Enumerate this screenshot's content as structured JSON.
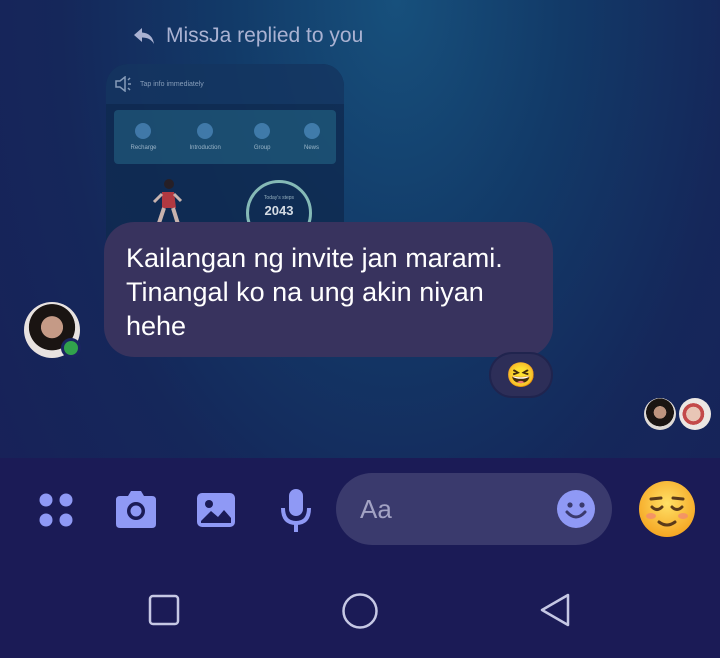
{
  "reply": {
    "header": "MissJa replied to you"
  },
  "quoted_preview": {
    "top_text": "Tap info immediately",
    "menu": [
      "Recharge",
      "Introduction",
      "Group",
      "News"
    ],
    "ring_label": "Today's steps",
    "ring_value": "2043"
  },
  "message": {
    "text": "Kailangan ng invite jan marami. Tinangal ko na ung akin niyan hehe",
    "reaction": "😆"
  },
  "composer": {
    "placeholder": "Aa",
    "quick_emoji": "😌"
  },
  "colors": {
    "accent": "#8f99f5",
    "bubble": "#38335e",
    "online": "#31a24c"
  },
  "icons": [
    "reply-arrow-icon",
    "apps-grid-icon",
    "camera-icon",
    "image-icon",
    "microphone-icon",
    "smiley-icon",
    "square-nav-icon",
    "circle-nav-icon",
    "back-triangle-icon"
  ]
}
